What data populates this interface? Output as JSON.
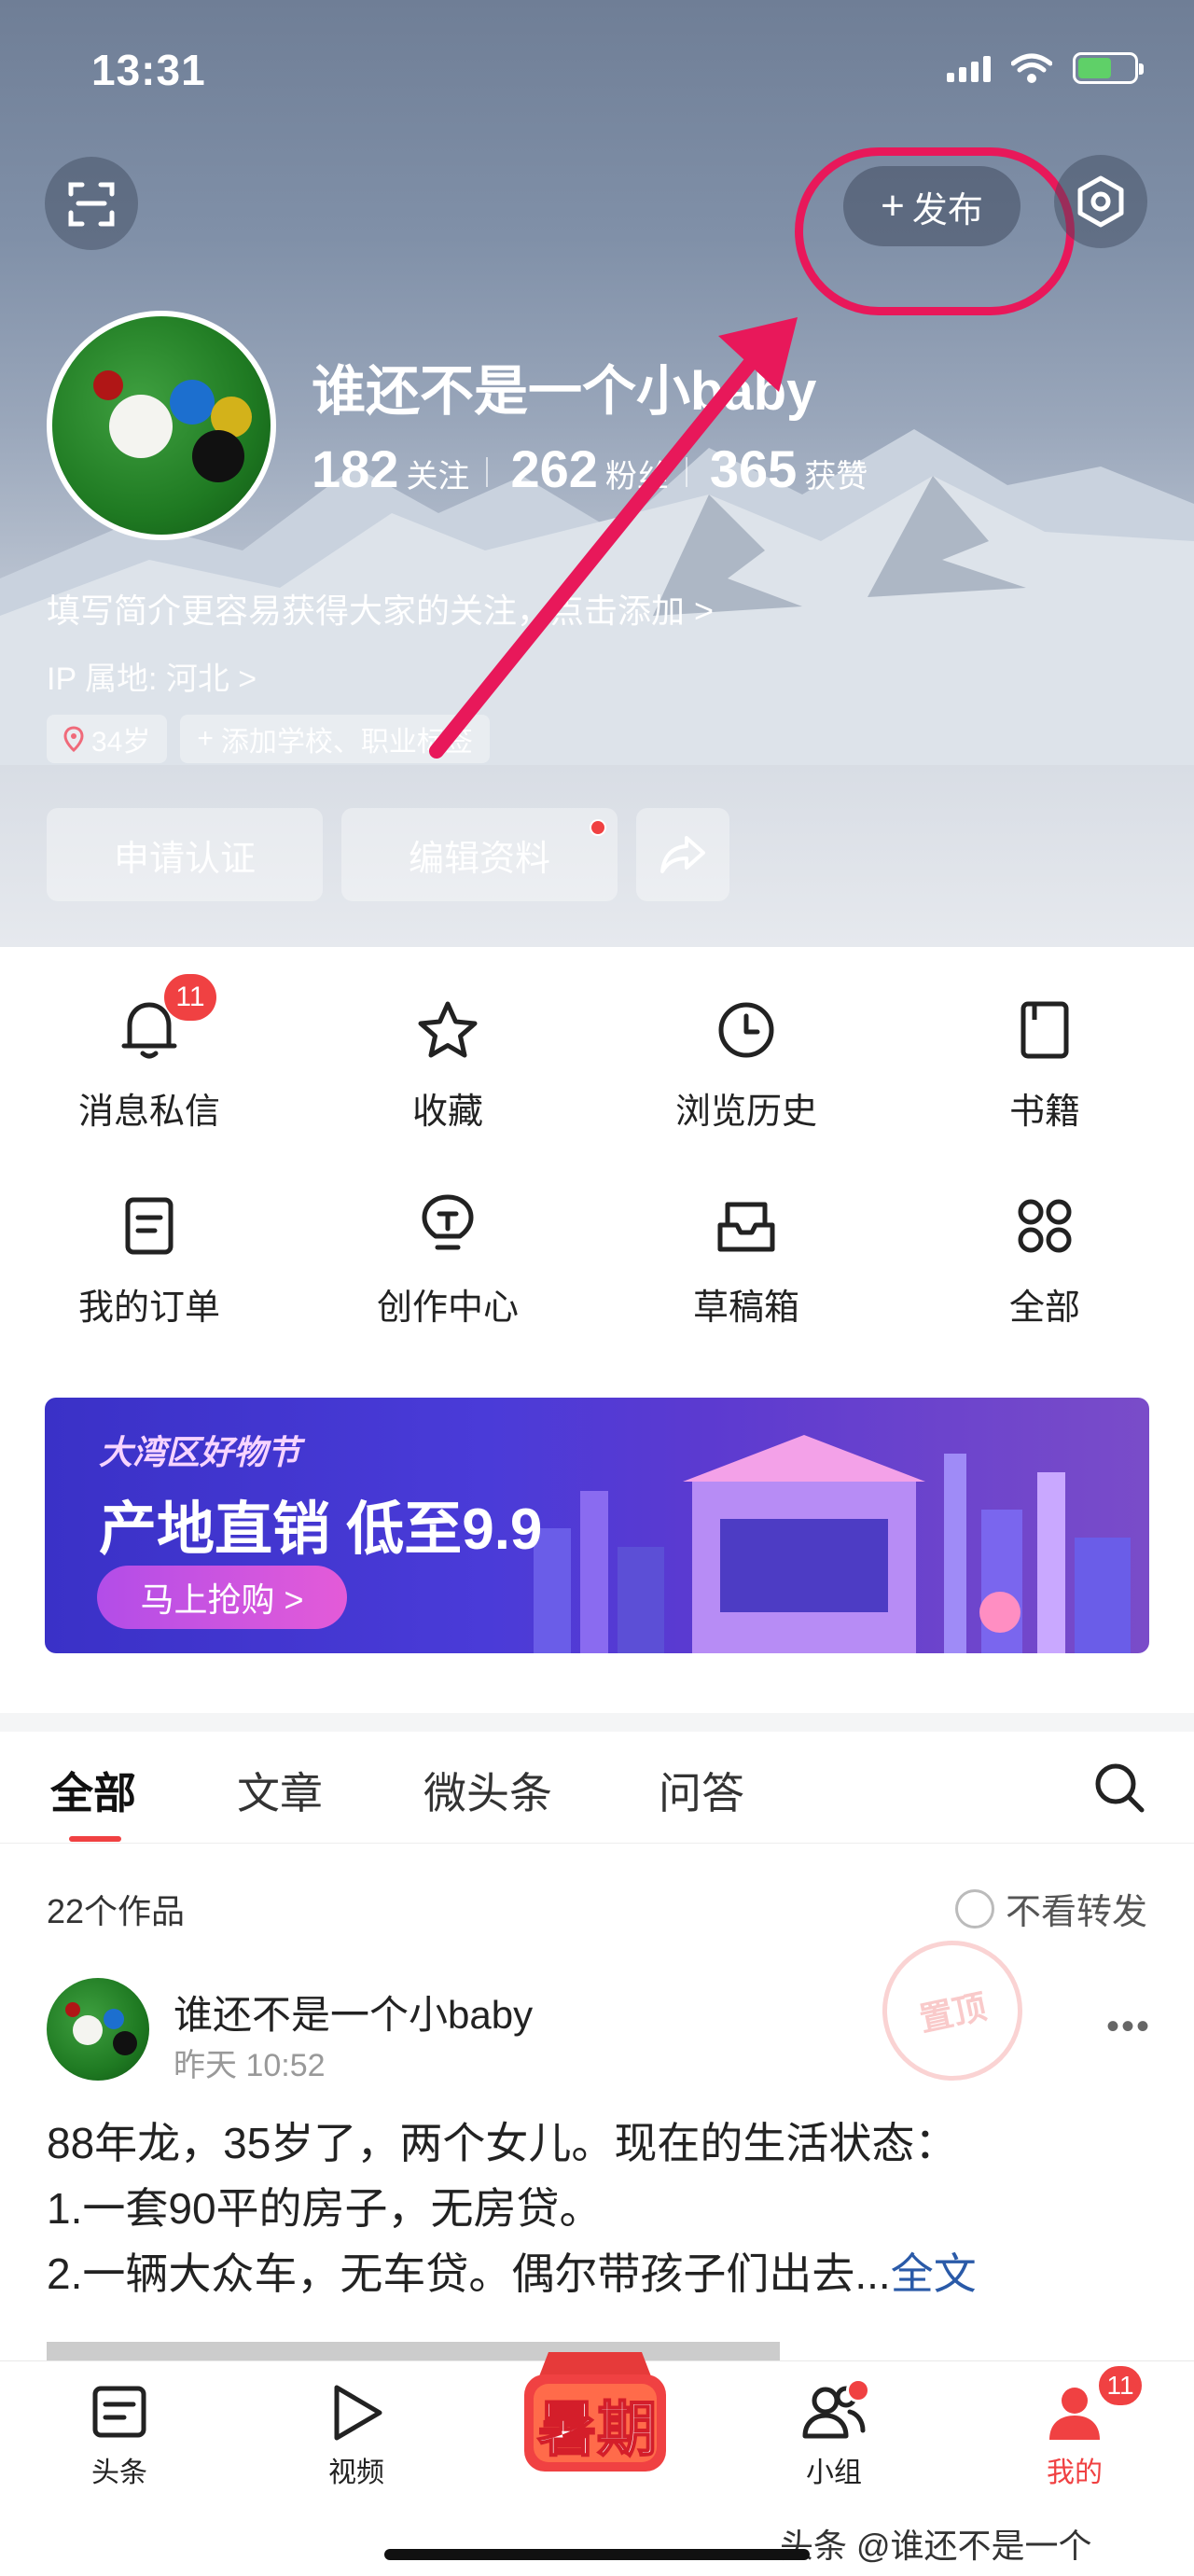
{
  "status_bar": {
    "time": "13:31"
  },
  "header": {
    "publish_label": "发布",
    "user_name": "谁还不是一个小baby",
    "stats": [
      {
        "value": "182",
        "label": "关注"
      },
      {
        "value": "262",
        "label": "粉丝"
      },
      {
        "value": "365",
        "label": "获赞"
      }
    ],
    "bio_prompt": "填写简介更容易获得大家的关注，点击添加 >",
    "ip_location": "IP 属地: 河北 >",
    "tags": [
      {
        "label": "34岁"
      },
      {
        "label": "添加学校、职业标签"
      }
    ],
    "buttons": {
      "verify": "申请认证",
      "edit_profile": "编辑资料"
    }
  },
  "quick_grid": [
    {
      "label": "消息私信",
      "icon": "bell-icon",
      "badge": "11"
    },
    {
      "label": "收藏",
      "icon": "star-icon"
    },
    {
      "label": "浏览历史",
      "icon": "clock-icon"
    },
    {
      "label": "书籍",
      "icon": "book-icon"
    },
    {
      "label": "我的订单",
      "icon": "order-icon"
    },
    {
      "label": "创作中心",
      "icon": "lightbulb-icon"
    },
    {
      "label": "草稿箱",
      "icon": "drafts-icon"
    },
    {
      "label": "全部",
      "icon": "grid-icon"
    }
  ],
  "banner": {
    "tag": "大湾区好物节",
    "title": "产地直销 低至9.9",
    "cta": "马上抢购 >"
  },
  "tabs": [
    {
      "label": "全部",
      "active": true
    },
    {
      "label": "文章"
    },
    {
      "label": "微头条"
    },
    {
      "label": "问答"
    }
  ],
  "works": {
    "count_text": "22个作品",
    "no_repost_label": "不看转发"
  },
  "post": {
    "author": "谁还不是一个小baby",
    "time": "昨天 10:52",
    "stamp_text": "置顶",
    "lines": [
      "88年龙，35岁了，两个女儿。现在的生活状态：",
      "1.一套90平的房子，无房贷。",
      "2.一辆大众车，无车贷。偶尔带孩子们出去..."
    ],
    "full_text_link": "全文"
  },
  "bottom_nav": [
    {
      "label": "头条",
      "icon": "news-icon"
    },
    {
      "label": "视频",
      "icon": "play-icon"
    },
    {
      "label": "暑期",
      "icon": "summer-promo-icon"
    },
    {
      "label": "小组",
      "icon": "group-icon",
      "dot": true
    },
    {
      "label": "我的",
      "icon": "profile-icon",
      "badge": "11",
      "active": true
    }
  ],
  "watermark": "头条 @谁还不是一个",
  "colors": {
    "accent": "#f04142",
    "highlight": "#e8185a",
    "link": "#2a5aa8",
    "banner": "#4a3bd8"
  }
}
